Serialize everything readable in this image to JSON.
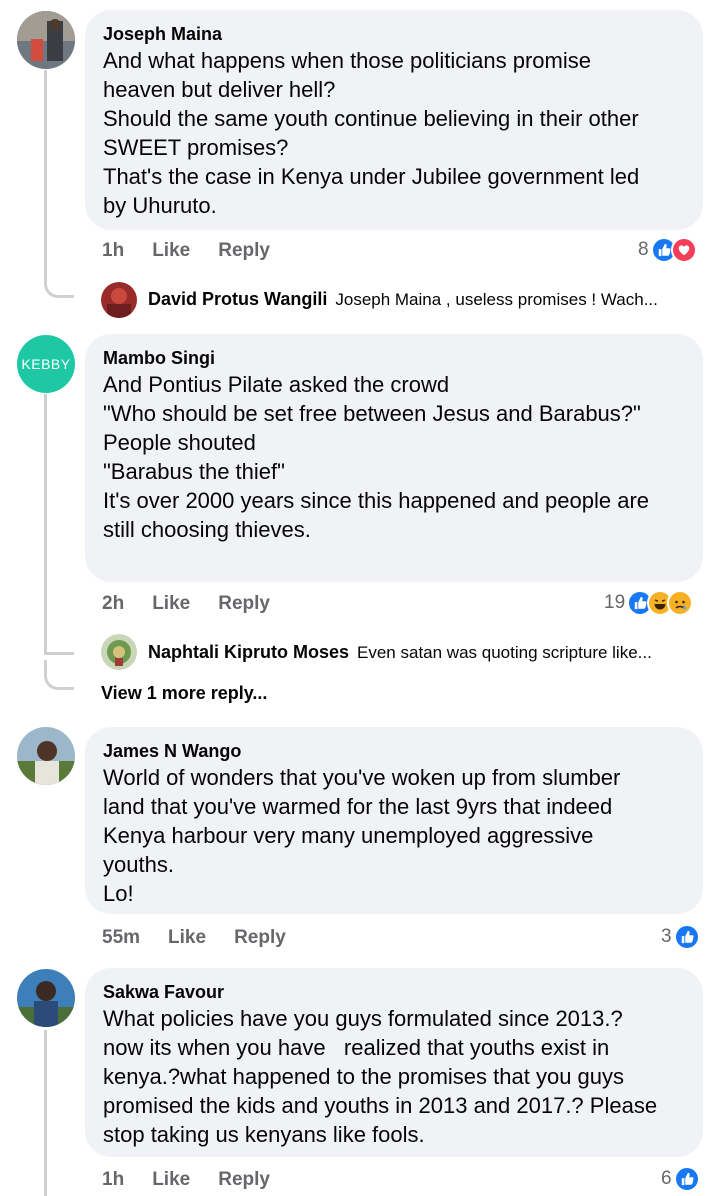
{
  "comments": [
    {
      "author": "Joseph Maina",
      "text": "And what happens when those politicians promise\nheaven but deliver hell?\nShould the same youth continue believing in their other\nSWEET promises?\nThat's the case in Kenya under Jubilee government led\nby Uhuruto.",
      "time": "1h",
      "like_label": "Like",
      "reply_label": "Reply",
      "reaction_count": "8",
      "reactions": [
        "like-icon",
        "love-icon"
      ],
      "reply": {
        "author": "David Protus Wangili",
        "text": "Joseph Maina , useless promises ! Wach..."
      }
    },
    {
      "author": "Mambo Singi",
      "avatar_text": "KEBBY",
      "text": "And Pontius Pilate asked the crowd\n\"Who should be set free between Jesus and Barabus?\"\nPeople shouted\n\"Barabus the thief\"\nIt's over 2000 years since this happened and people are\nstill choosing thieves.",
      "time": "2h",
      "like_label": "Like",
      "reply_label": "Reply",
      "reaction_count": "19",
      "reactions": [
        "like-icon",
        "haha-icon",
        "sad-icon"
      ],
      "reply": {
        "author": "Naphtali Kipruto Moses",
        "text": "Even satan was quoting scripture like..."
      },
      "view_more": "View 1 more reply..."
    },
    {
      "author": "James N Wango",
      "text": "World of wonders that you've woken up from slumber\nland that you've warmed for the last 9yrs that indeed\nKenya harbour very many unemployed aggressive\nyouths.\nLo!",
      "time": "55m",
      "like_label": "Like",
      "reply_label": "Reply",
      "reaction_count": "3",
      "reactions": [
        "like-icon"
      ]
    },
    {
      "author": "Sakwa Favour",
      "text": "What policies have you guys formulated since 2013.?\nnow its when you have   realized that youths exist in\nkenya.?what happened to the promises that you guys\npromised the kids and youths in 2013 and 2017.? Please\nstop taking us kenyans like fools.",
      "time": "1h",
      "like_label": "Like",
      "reply_label": "Reply",
      "reaction_count": "6",
      "reactions": [
        "like-icon"
      ]
    }
  ],
  "colors": {
    "bubble": "#f0f2f5",
    "meta": "#65676b",
    "like": "#1877f2",
    "love": "#f33e58",
    "haha": "#f7b125",
    "kebby": "#1ec8a5"
  }
}
